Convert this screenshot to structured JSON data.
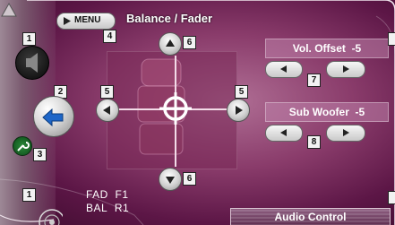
{
  "header": {
    "title": "Balance / Fader",
    "menu_label": "MENU"
  },
  "callouts": [
    "1",
    "2",
    "3",
    "4",
    "5",
    "6",
    "7",
    "8"
  ],
  "vol_offset": {
    "label": "Vol. Offset",
    "value": "-5"
  },
  "sub_woofer": {
    "label": "Sub Woofer",
    "value": "-5"
  },
  "status": {
    "fader_label": "FAD",
    "fader_value": "F1",
    "balance_label": "BAL",
    "balance_value": "R1"
  },
  "footer": {
    "audio_control_label": "Audio Control"
  },
  "colors": {
    "accent": "#8a3c6b",
    "panel": "#be82aa",
    "button_face": "#e8e8e8"
  },
  "icons": [
    "speaker-icon",
    "return-icon",
    "wrench-icon",
    "crosshair-icon",
    "seat-icon"
  ]
}
